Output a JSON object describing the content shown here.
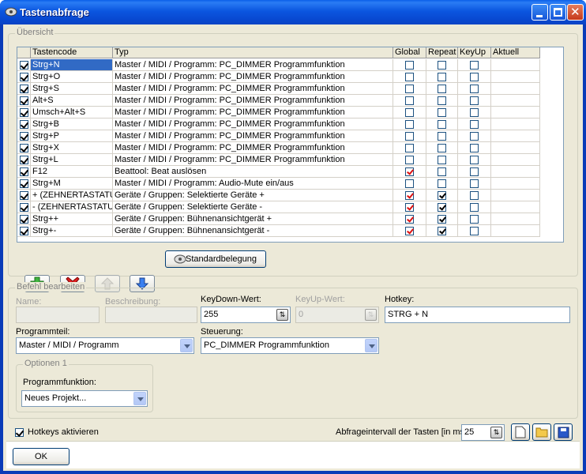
{
  "window": {
    "title": "Tastenabfrage"
  },
  "overview": {
    "title": "Übersicht",
    "columns": [
      "Tastencode",
      "Typ",
      "Global",
      "Repeat",
      "KeyUp",
      "Aktuell"
    ],
    "rows": [
      {
        "code": "Strg+N",
        "typ": "Master / MIDI / Programm: PC_DIMMER Programmfunktion",
        "enabled": true,
        "global": false,
        "repeat": false,
        "keyup": false
      },
      {
        "code": "Strg+O",
        "typ": "Master / MIDI / Programm: PC_DIMMER Programmfunktion",
        "enabled": true,
        "global": false,
        "repeat": false,
        "keyup": false
      },
      {
        "code": "Strg+S",
        "typ": "Master / MIDI / Programm: PC_DIMMER Programmfunktion",
        "enabled": true,
        "global": false,
        "repeat": false,
        "keyup": false
      },
      {
        "code": "Alt+S",
        "typ": "Master / MIDI / Programm: PC_DIMMER Programmfunktion",
        "enabled": true,
        "global": false,
        "repeat": false,
        "keyup": false
      },
      {
        "code": "Umsch+Alt+S",
        "typ": "Master / MIDI / Programm: PC_DIMMER Programmfunktion",
        "enabled": true,
        "global": false,
        "repeat": false,
        "keyup": false
      },
      {
        "code": "Strg+B",
        "typ": "Master / MIDI / Programm: PC_DIMMER Programmfunktion",
        "enabled": true,
        "global": false,
        "repeat": false,
        "keyup": false
      },
      {
        "code": "Strg+P",
        "typ": "Master / MIDI / Programm: PC_DIMMER Programmfunktion",
        "enabled": true,
        "global": false,
        "repeat": false,
        "keyup": false
      },
      {
        "code": "Strg+X",
        "typ": "Master / MIDI / Programm: PC_DIMMER Programmfunktion",
        "enabled": true,
        "global": false,
        "repeat": false,
        "keyup": false
      },
      {
        "code": "Strg+L",
        "typ": "Master / MIDI / Programm: PC_DIMMER Programmfunktion",
        "enabled": true,
        "global": false,
        "repeat": false,
        "keyup": false
      },
      {
        "code": "F12",
        "typ": "Beattool: Beat auslösen",
        "enabled": true,
        "global": true,
        "repeat": false,
        "keyup": false
      },
      {
        "code": "Strg+M",
        "typ": "Master / MIDI / Programm: Audio-Mute ein/aus",
        "enabled": true,
        "global": false,
        "repeat": false,
        "keyup": false
      },
      {
        "code": "+ (ZEHNERTASTATUR)",
        "typ": "Geräte / Gruppen: Selektierte Geräte +",
        "enabled": true,
        "global": true,
        "repeat": true,
        "keyup": false
      },
      {
        "code": "- (ZEHNERTASTATUR)",
        "typ": "Geräte / Gruppen: Selektierte Geräte -",
        "enabled": true,
        "global": true,
        "repeat": true,
        "keyup": false
      },
      {
        "code": "Strg++",
        "typ": "Geräte / Gruppen: Bühnenansichtgerät +",
        "enabled": true,
        "global": true,
        "repeat": true,
        "keyup": false
      },
      {
        "code": "Strg+-",
        "typ": "Geräte / Gruppen: Bühnenansichtgerät -",
        "enabled": true,
        "global": true,
        "repeat": true,
        "keyup": false
      }
    ],
    "standard_label": "Standardbelegung"
  },
  "edit": {
    "title": "Befehl bearbeiten",
    "name_label": "Name:",
    "name_value": "",
    "desc_label": "Beschreibung:",
    "desc_value": "",
    "keydown_label": "KeyDown-Wert:",
    "keydown_value": "255",
    "keyup_label": "KeyUp-Wert:",
    "keyup_value": "0",
    "hotkey_label": "Hotkey:",
    "hotkey_value": "STRG + N",
    "prog_label": "Programmteil:",
    "prog_value": "Master / MIDI / Programm",
    "steuerung_label": "Steuerung:",
    "steuerung_value": "PC_DIMMER Programmfunktion",
    "options_title": "Optionen 1",
    "progfunc_label": "Programmfunktion:",
    "progfunc_value": "Neues Projekt..."
  },
  "footer": {
    "hotkeys_label": "Hotkeys aktivieren",
    "hotkeys_checked": true,
    "interval_label": "Abfrageintervall der Tasten [in ms]:",
    "interval_value": "25",
    "ok_label": "OK"
  }
}
